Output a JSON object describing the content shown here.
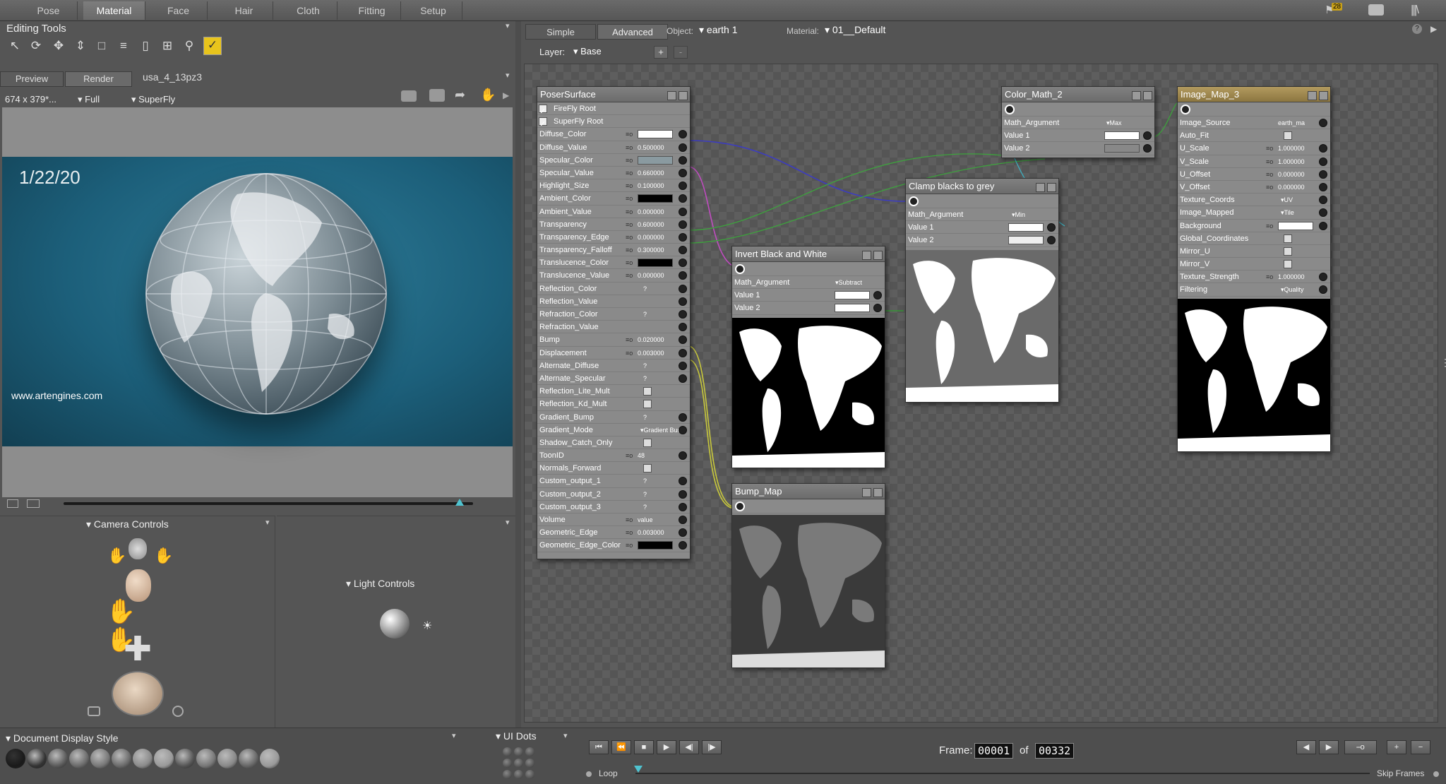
{
  "top_tabs": [
    "Pose",
    "Material",
    "Face",
    "Hair",
    "Cloth",
    "Fitting",
    "Setup"
  ],
  "active_tab": "Material",
  "notification_count": "28",
  "editing_tools": {
    "title": "Editing Tools"
  },
  "preview": {
    "tabs": [
      "Preview",
      "Render"
    ],
    "scene_name": "usa_4_13pz3",
    "resolution": "674 x 379*...",
    "quality": "Full",
    "renderer": "SuperFly",
    "date_text": "1/22/20",
    "watermark": "www.artengines.com"
  },
  "camera_controls": {
    "title": "Camera Controls"
  },
  "light_controls": {
    "title": "Light Controls"
  },
  "doc_display": {
    "title": "Document Display Style"
  },
  "ui_dots": {
    "title": "UI Dots"
  },
  "material_room": {
    "modes": [
      "Simple",
      "Advanced"
    ],
    "object_label": "Object:",
    "object_value": "earth 1",
    "material_label": "Material:",
    "material_value": "01__Default",
    "layer_label": "Layer:",
    "layer_value": "Base",
    "add_layer": "+",
    "remove_layer": "-"
  },
  "poser_surface": {
    "title": "PoserSurface",
    "roots": [
      "FireFly Root",
      "SuperFly Root"
    ],
    "rows": [
      {
        "n": "Diffuse_Color",
        "t": "color",
        "c": "#ffffff"
      },
      {
        "n": "Diffuse_Value",
        "t": "num",
        "v": "0.500000"
      },
      {
        "n": "Specular_Color",
        "t": "color",
        "c": "#8a9aa0"
      },
      {
        "n": "Specular_Value",
        "t": "num",
        "v": "0.660000"
      },
      {
        "n": "Highlight_Size",
        "t": "num",
        "v": "0.100000"
      },
      {
        "n": "Ambient_Color",
        "t": "color",
        "c": "#000000"
      },
      {
        "n": "Ambient_Value",
        "t": "num",
        "v": "0.000000"
      },
      {
        "n": "Transparency",
        "t": "num",
        "v": "0.600000"
      },
      {
        "n": "Transparency_Edge",
        "t": "num",
        "v": "0.000000"
      },
      {
        "n": "Transparency_Falloff",
        "t": "num",
        "v": "0.300000"
      },
      {
        "n": "Translucence_Color",
        "t": "color",
        "c": "#000000"
      },
      {
        "n": "Translucence_Value",
        "t": "num",
        "v": "0.000000"
      },
      {
        "n": "Reflection_Color",
        "t": "q",
        "v": "?"
      },
      {
        "n": "Reflection_Value",
        "t": "none"
      },
      {
        "n": "Refraction_Color",
        "t": "q",
        "v": "?"
      },
      {
        "n": "Refraction_Value",
        "t": "none"
      },
      {
        "n": "Bump",
        "t": "num",
        "v": "0.020000"
      },
      {
        "n": "Displacement",
        "t": "num",
        "v": "0.003000"
      },
      {
        "n": "Alternate_Diffuse",
        "t": "q",
        "v": "?"
      },
      {
        "n": "Alternate_Specular",
        "t": "q",
        "v": "?"
      },
      {
        "n": "Reflection_Lite_Mult",
        "t": "cb"
      },
      {
        "n": "Reflection_Kd_Mult",
        "t": "cb"
      },
      {
        "n": "Gradient_Bump",
        "t": "q",
        "v": "?"
      },
      {
        "n": "Gradient_Mode",
        "t": "dd",
        "v": "Gradient Bump"
      },
      {
        "n": "Shadow_Catch_Only",
        "t": "cb"
      },
      {
        "n": "ToonID",
        "t": "num",
        "v": "48"
      },
      {
        "n": "Normals_Forward",
        "t": "cb"
      },
      {
        "n": "Custom_output_1",
        "t": "q",
        "v": "?"
      },
      {
        "n": "Custom_output_2",
        "t": "q",
        "v": "?"
      },
      {
        "n": "Custom_output_3",
        "t": "q",
        "v": "?"
      },
      {
        "n": "Volume",
        "t": "num",
        "v": "value"
      },
      {
        "n": "Geometric_Edge",
        "t": "num",
        "v": "0.003000"
      },
      {
        "n": "Geometric_Edge_Color",
        "t": "color",
        "c": "#000000"
      }
    ]
  },
  "invert_node": {
    "title": "Invert Black and White",
    "arg_label": "Math_Argument",
    "arg_value": "Subtract",
    "v1": "Value 1",
    "v2": "Value 2"
  },
  "clamp_node": {
    "title": "Clamp blacks to grey",
    "arg_label": "Math_Argument",
    "arg_value": "Min",
    "v1": "Value 1",
    "v2": "Value 2"
  },
  "color_math_node": {
    "title": "Color_Math_2",
    "arg_label": "Math_Argument",
    "arg_value": "Max",
    "v1": "Value 1",
    "v2": "Value 2"
  },
  "bump_node": {
    "title": "Bump_Map"
  },
  "image_map_node": {
    "title": "Image_Map_3",
    "rows": [
      {
        "n": "Image_Source",
        "t": "text",
        "v": "earth_ma"
      },
      {
        "n": "Auto_Fit",
        "t": "cb"
      },
      {
        "n": "U_Scale",
        "t": "num",
        "v": "1.000000"
      },
      {
        "n": "V_Scale",
        "t": "num",
        "v": "1.000000"
      },
      {
        "n": "U_Offset",
        "t": "num",
        "v": "0.000000"
      },
      {
        "n": "V_Offset",
        "t": "num",
        "v": "0.000000"
      },
      {
        "n": "Texture_Coords",
        "t": "dd",
        "v": "UV"
      },
      {
        "n": "Image_Mapped",
        "t": "dd",
        "v": "Tile"
      },
      {
        "n": "Background",
        "t": "color",
        "c": "#ffffff"
      },
      {
        "n": "Global_Coordinates",
        "t": "cb"
      },
      {
        "n": "Mirror_U",
        "t": "cb"
      },
      {
        "n": "Mirror_V",
        "t": "cb"
      },
      {
        "n": "Texture_Strength",
        "t": "num",
        "v": "1.000000"
      },
      {
        "n": "Filtering",
        "t": "dd",
        "v": "Quality"
      }
    ]
  },
  "timeline": {
    "frame_label": "Frame:",
    "frame_current": "00001",
    "frame_of": "of",
    "frame_total": "00332",
    "loop_label": "Loop",
    "skip_label": "Skip Frames"
  }
}
